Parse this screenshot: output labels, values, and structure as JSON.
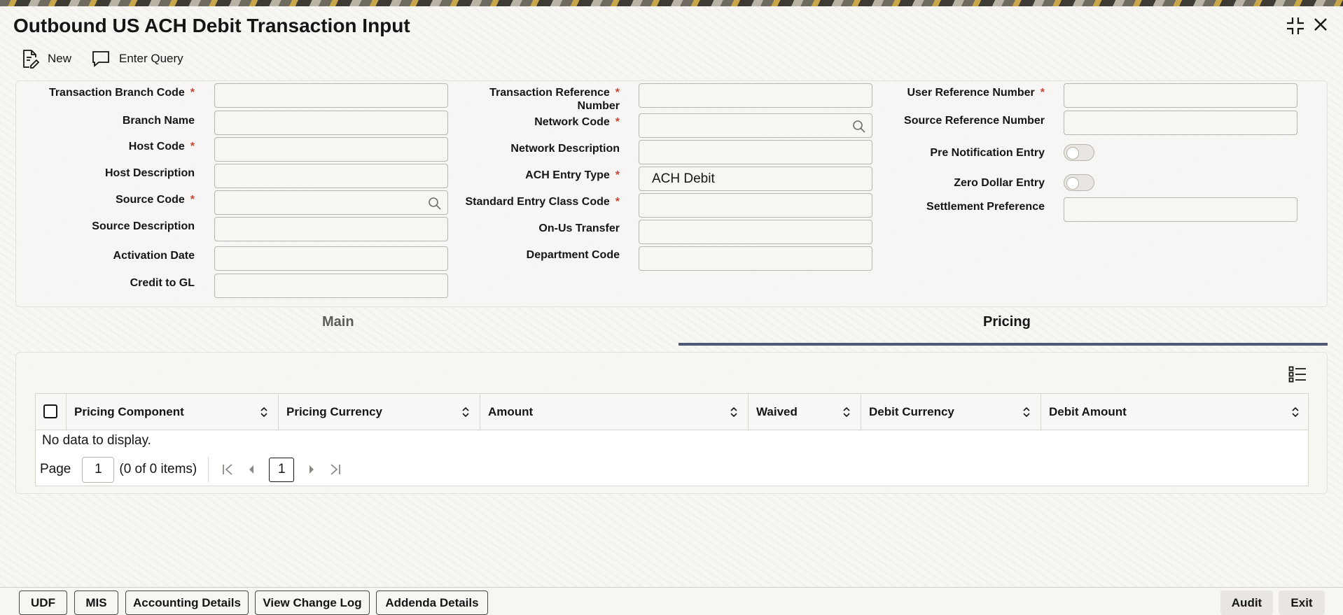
{
  "window": {
    "title": "Outbound US ACH Debit Transaction Input"
  },
  "toolbar": {
    "new_label": "New",
    "enter_query_label": "Enter Query"
  },
  "form": {
    "transaction_branch_code": {
      "label": "Transaction Branch Code",
      "value": ""
    },
    "branch_name": {
      "label": "Branch Name",
      "value": ""
    },
    "host_code": {
      "label": "Host Code",
      "value": ""
    },
    "host_description": {
      "label": "Host Description",
      "value": ""
    },
    "source_code": {
      "label": "Source Code",
      "value": ""
    },
    "source_description": {
      "label": "Source Description",
      "value": ""
    },
    "activation_date": {
      "label": "Activation Date",
      "value": ""
    },
    "credit_to_gl": {
      "label": "Credit to GL",
      "value": ""
    },
    "transaction_reference_number": {
      "label_line1": "Transaction Reference",
      "label_line2": "Number",
      "value": ""
    },
    "network_code": {
      "label": "Network Code",
      "value": ""
    },
    "network_description": {
      "label": "Network Description",
      "value": ""
    },
    "ach_entry_type": {
      "label": "ACH Entry Type",
      "value": "ACH Debit"
    },
    "standard_entry_class_code": {
      "label": "Standard Entry Class Code",
      "value": ""
    },
    "on_us_transfer": {
      "label": "On-Us Transfer",
      "value": ""
    },
    "department_code": {
      "label": "Department Code",
      "value": ""
    },
    "user_reference_number": {
      "label": "User Reference Number",
      "value": ""
    },
    "source_reference_number": {
      "label": "Source Reference Number",
      "value": ""
    },
    "pre_notification_entry": {
      "label": "Pre Notification Entry",
      "checked": false
    },
    "zero_dollar_entry": {
      "label": "Zero Dollar Entry",
      "checked": false
    },
    "settlement_preference": {
      "label": "Settlement Preference",
      "value": ""
    },
    "required_mark": "*"
  },
  "tabs": [
    {
      "label": "Main",
      "active": false
    },
    {
      "label": "Pricing",
      "active": true
    }
  ],
  "pricing_grid": {
    "columns": [
      "Pricing Component",
      "Pricing Currency",
      "Amount",
      "Waived",
      "Debit Currency",
      "Debit Amount"
    ],
    "rows": [],
    "empty_message": "No data to display.",
    "pager": {
      "page_label": "Page",
      "page_value": "1",
      "items_info": "(0 of 0 items)",
      "current_page": "1"
    }
  },
  "footer": {
    "buttons": [
      "UDF",
      "MIS",
      "Accounting Details",
      "View Change Log",
      "Addenda Details"
    ],
    "audit_label": "Audit",
    "exit_label": "Exit"
  },
  "colors": {
    "required": "#c74634",
    "tab_underline": "#4d5976",
    "text": "#161513"
  }
}
